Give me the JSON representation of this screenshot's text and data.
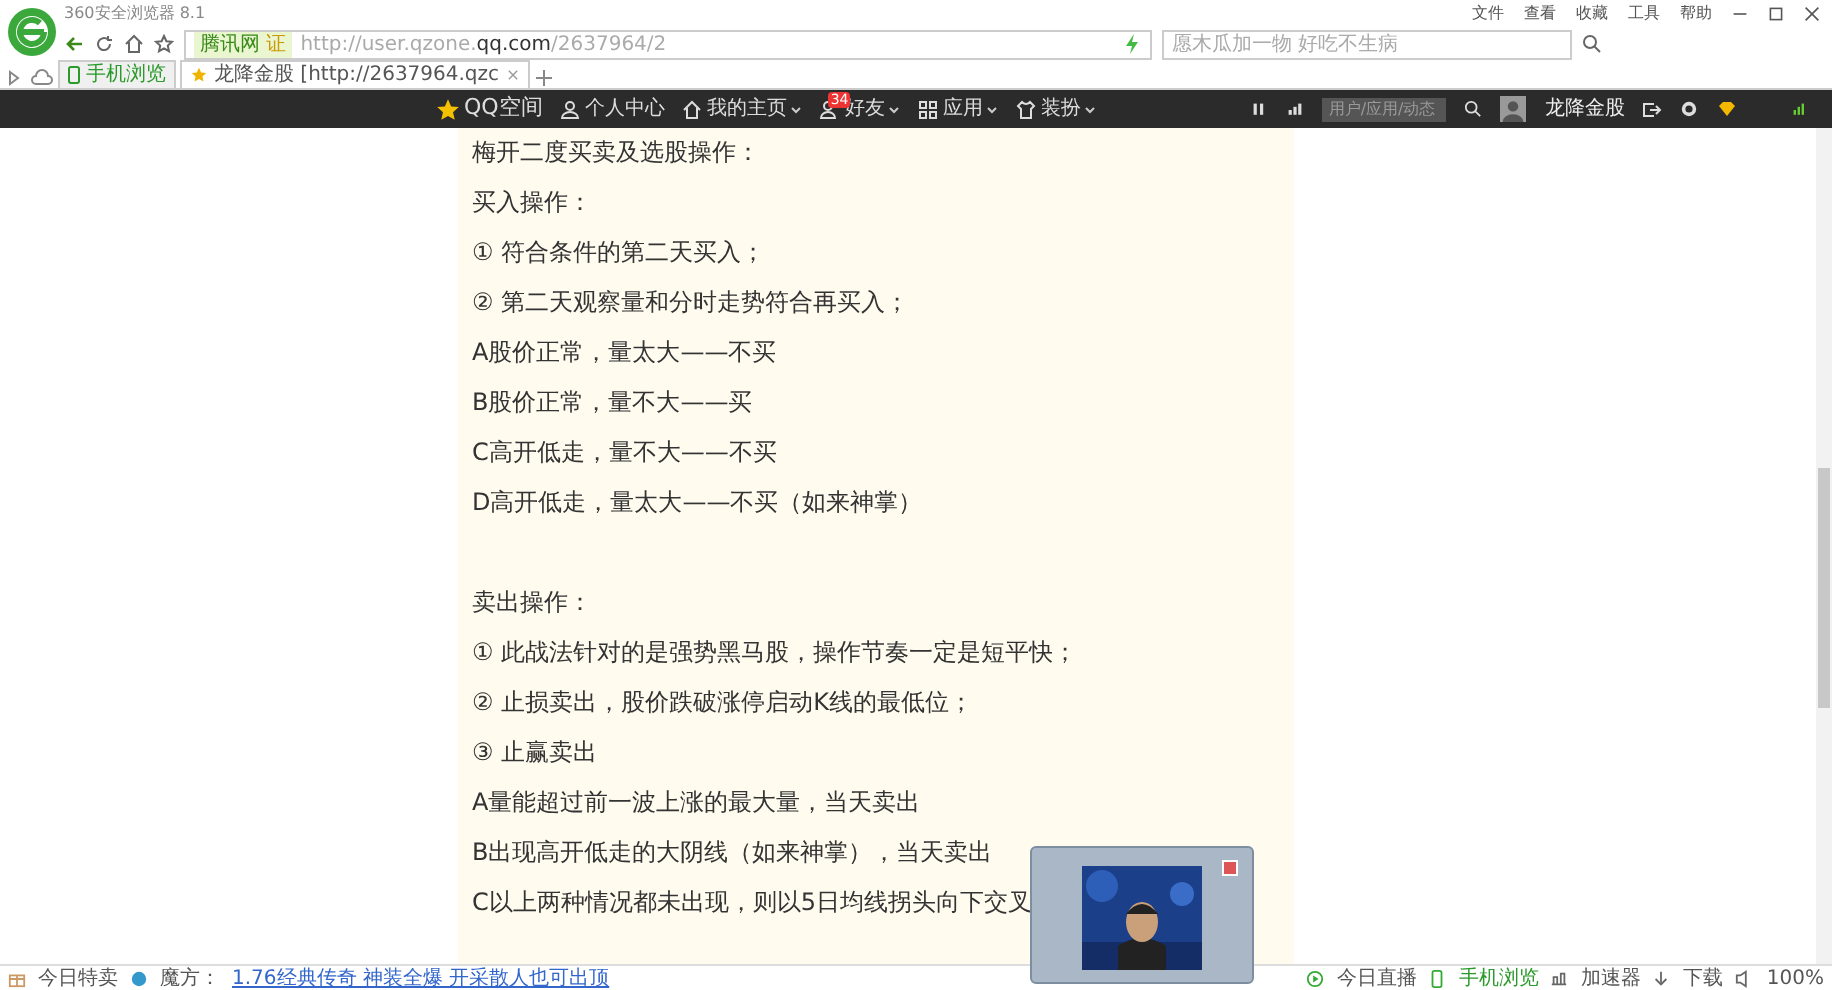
{
  "browser": {
    "title": "360安全浏览器 8.1",
    "menu": [
      "文件",
      "查看",
      "收藏",
      "工具",
      "帮助"
    ],
    "address": {
      "site_badge": "腾讯网",
      "cert": "证",
      "prefix": "http://user.qzone.",
      "domain": "qq.com",
      "path": "/2637964/2"
    },
    "search": {
      "placeholder": "愿木瓜加一物 好吃不生病"
    },
    "tabs": [
      {
        "label": "手机浏览",
        "kind": "pinned",
        "selected": false
      },
      {
        "label": "龙降金股 [http://2637964.qzc",
        "kind": "page",
        "selected": true
      }
    ]
  },
  "qzone_nav": {
    "logo": "QQ空间",
    "items": [
      {
        "label": "个人中心",
        "dropdown": false
      },
      {
        "label": "我的主页",
        "dropdown": true
      },
      {
        "label": "好友",
        "dropdown": true,
        "badge": "34"
      },
      {
        "label": "应用",
        "dropdown": true
      },
      {
        "label": "装扮",
        "dropdown": true
      }
    ],
    "search": {
      "placeholder": "用户/应用/动态"
    },
    "user": "龙降金股"
  },
  "article": {
    "sections": [
      {
        "lines": [
          "梅开二度买卖及选股操作：",
          "买入操作：",
          "①  符合条件的第二天买入；",
          "②  第二天观察量和分时走势符合再买入；",
          "A股价正常，量太大——不买",
          "B股价正常，量不大——买",
          "C高开低走，量不大——不买",
          "D高开低走，量太大——不买（如来神掌）"
        ]
      },
      {
        "lines": [
          "卖出操作：",
          "①  此战法针对的是强势黑马股，操作节奏一定是短平快；",
          "②  止损卖出，股价跌破涨停启动K线的最低位；",
          "③  止赢卖出",
          "A量能超过前一波上涨的最大量，当天卖出",
          "B出现高开低走的大阴线（如来神掌），当天卖出",
          "C以上两种情况都未出现，则以5日均线拐头向下交叉"
        ]
      }
    ]
  },
  "status_bar": {
    "left": [
      "今日特卖",
      "魔方："
    ],
    "link": "1.76经典传奇 神装全爆 开采散人也可出顶",
    "right": [
      "今日直播",
      "手机浏览",
      "加速器",
      "下载"
    ],
    "zoom": "100%"
  }
}
